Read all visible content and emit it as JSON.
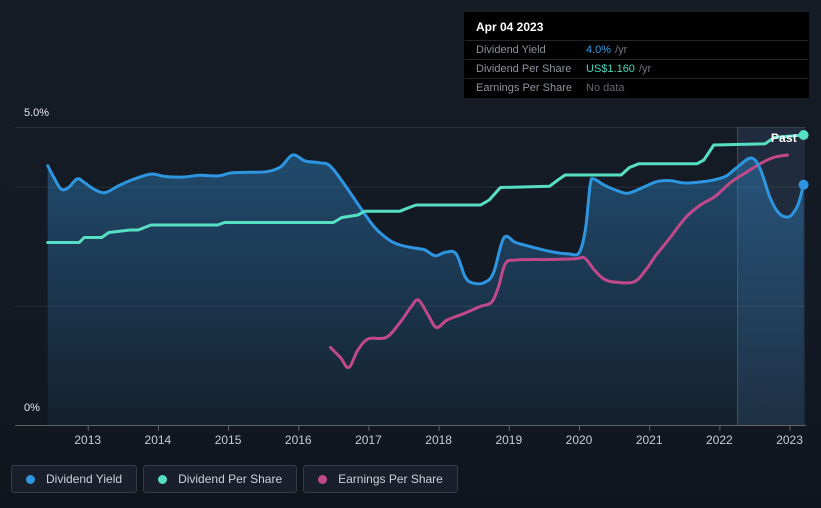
{
  "tooltip": {
    "date": "Apr 04 2023",
    "rows": [
      {
        "label": "Dividend Yield",
        "value": "4.0%",
        "suffix": "/yr",
        "value_color": "#2f9fe9"
      },
      {
        "label": "Dividend Per Share",
        "value": "US$1.160",
        "suffix": "/yr",
        "value_color": "#4cd6ba"
      },
      {
        "label": "Earnings Per Share",
        "value": "No data",
        "suffix": "",
        "value_color": "#62686f"
      }
    ]
  },
  "chart": {
    "past_label": "Past",
    "y_top_label": "5.0%",
    "y_bottom_label": "0%",
    "x_ticks": [
      "2013",
      "2014",
      "2015",
      "2016",
      "2017",
      "2018",
      "2019",
      "2020",
      "2021",
      "2022",
      "2023"
    ]
  },
  "legend": [
    {
      "label": "Dividend Yield",
      "color": "#2e96e0"
    },
    {
      "label": "Dividend Per Share",
      "color": "#57dfc4"
    },
    {
      "label": "Earnings Per Share",
      "color": "#c1498b"
    }
  ],
  "chart_data": {
    "type": "line",
    "xlim": [
      2012.42,
      2023.22
    ],
    "ylim_percent": [
      0,
      5
    ],
    "usd_axis_max": 1.192,
    "x_tick_years": [
      2013,
      2014,
      2015,
      2016,
      2017,
      2018,
      2019,
      2020,
      2021,
      2022,
      2023
    ],
    "y_tick_labels": [
      "5.0%",
      "0%"
    ],
    "gridline_percents": [
      5,
      4,
      2
    ],
    "grid": true,
    "legend_position": "bottom-left",
    "past_band_start_year": 2022.26,
    "series": [
      {
        "name": "Earnings Per Share",
        "unit": "USD",
        "axis": "usd",
        "color": "#c1498b",
        "smooth": true,
        "end_dot": false,
        "area_fill": false,
        "points": [
          [
            2016.46,
            0.31
          ],
          [
            2016.6,
            0.27
          ],
          [
            2016.72,
            0.23
          ],
          [
            2016.85,
            0.3
          ],
          [
            2017.0,
            0.345
          ],
          [
            2017.25,
            0.35
          ],
          [
            2017.45,
            0.41
          ],
          [
            2017.6,
            0.47
          ],
          [
            2017.71,
            0.5
          ],
          [
            2017.85,
            0.44
          ],
          [
            2017.97,
            0.39
          ],
          [
            2018.12,
            0.42
          ],
          [
            2018.35,
            0.445
          ],
          [
            2018.6,
            0.475
          ],
          [
            2018.75,
            0.49
          ],
          [
            2018.85,
            0.55
          ],
          [
            2018.95,
            0.645
          ],
          [
            2019.1,
            0.66
          ],
          [
            2019.6,
            0.662
          ],
          [
            2019.95,
            0.665
          ],
          [
            2020.08,
            0.668
          ],
          [
            2020.22,
            0.62
          ],
          [
            2020.35,
            0.585
          ],
          [
            2020.5,
            0.572
          ],
          [
            2020.78,
            0.572
          ],
          [
            2020.95,
            0.62
          ],
          [
            2021.1,
            0.68
          ],
          [
            2021.3,
            0.75
          ],
          [
            2021.52,
            0.83
          ],
          [
            2021.73,
            0.88
          ],
          [
            2021.94,
            0.915
          ],
          [
            2022.16,
            0.97
          ],
          [
            2022.38,
            1.01
          ],
          [
            2022.58,
            1.045
          ],
          [
            2022.77,
            1.07
          ],
          [
            2022.97,
            1.08
          ]
        ]
      },
      {
        "name": "Dividend Yield",
        "unit": "%",
        "axis": "percent",
        "color": "#2e96e0",
        "smooth": true,
        "end_dot": true,
        "area_fill": true,
        "points": [
          [
            2012.43,
            4.35
          ],
          [
            2012.52,
            4.15
          ],
          [
            2012.62,
            3.96
          ],
          [
            2012.72,
            3.98
          ],
          [
            2012.85,
            4.13
          ],
          [
            2012.95,
            4.07
          ],
          [
            2013.1,
            3.95
          ],
          [
            2013.25,
            3.9
          ],
          [
            2013.45,
            4.02
          ],
          [
            2013.65,
            4.12
          ],
          [
            2013.9,
            4.21
          ],
          [
            2014.1,
            4.17
          ],
          [
            2014.35,
            4.16
          ],
          [
            2014.6,
            4.19
          ],
          [
            2014.85,
            4.18
          ],
          [
            2015.05,
            4.23
          ],
          [
            2015.3,
            4.24
          ],
          [
            2015.55,
            4.25
          ],
          [
            2015.75,
            4.33
          ],
          [
            2015.92,
            4.53
          ],
          [
            2016.1,
            4.43
          ],
          [
            2016.3,
            4.4
          ],
          [
            2016.45,
            4.35
          ],
          [
            2016.65,
            4.05
          ],
          [
            2016.93,
            3.57
          ],
          [
            2017.1,
            3.3
          ],
          [
            2017.3,
            3.1
          ],
          [
            2017.45,
            3.02
          ],
          [
            2017.65,
            2.97
          ],
          [
            2017.8,
            2.94
          ],
          [
            2017.95,
            2.84
          ],
          [
            2018.1,
            2.9
          ],
          [
            2018.25,
            2.87
          ],
          [
            2018.38,
            2.48
          ],
          [
            2018.5,
            2.38
          ],
          [
            2018.65,
            2.39
          ],
          [
            2018.78,
            2.55
          ],
          [
            2018.93,
            3.14
          ],
          [
            2019.1,
            3.06
          ],
          [
            2019.35,
            2.98
          ],
          [
            2019.6,
            2.91
          ],
          [
            2019.85,
            2.87
          ],
          [
            2020.0,
            2.89
          ],
          [
            2020.09,
            3.27
          ],
          [
            2020.16,
            4.03
          ],
          [
            2020.21,
            4.13
          ],
          [
            2020.35,
            4.03
          ],
          [
            2020.55,
            3.93
          ],
          [
            2020.7,
            3.89
          ],
          [
            2020.9,
            3.98
          ],
          [
            2021.1,
            4.08
          ],
          [
            2021.3,
            4.1
          ],
          [
            2021.5,
            4.06
          ],
          [
            2021.75,
            4.08
          ],
          [
            2021.95,
            4.12
          ],
          [
            2022.1,
            4.18
          ],
          [
            2022.25,
            4.32
          ],
          [
            2022.45,
            4.48
          ],
          [
            2022.58,
            4.3
          ],
          [
            2022.72,
            3.82
          ],
          [
            2022.85,
            3.55
          ],
          [
            2022.98,
            3.49
          ],
          [
            2023.06,
            3.57
          ],
          [
            2023.13,
            3.73
          ],
          [
            2023.2,
            4.03
          ]
        ]
      },
      {
        "name": "Dividend Per Share",
        "unit": "USD",
        "axis": "usd",
        "color": "#57dfc4",
        "smooth": false,
        "end_dot": true,
        "area_fill": false,
        "points": [
          [
            2012.43,
            0.73
          ],
          [
            2012.88,
            0.73
          ],
          [
            2012.95,
            0.75
          ],
          [
            2013.2,
            0.75
          ],
          [
            2013.3,
            0.77
          ],
          [
            2013.6,
            0.78
          ],
          [
            2013.72,
            0.78
          ],
          [
            2013.9,
            0.8
          ],
          [
            2014.85,
            0.8
          ],
          [
            2014.95,
            0.81
          ],
          [
            2016.5,
            0.81
          ],
          [
            2016.62,
            0.83
          ],
          [
            2016.85,
            0.84
          ],
          [
            2016.95,
            0.855
          ],
          [
            2017.45,
            0.855
          ],
          [
            2017.58,
            0.87
          ],
          [
            2017.68,
            0.88
          ],
          [
            2018.6,
            0.88
          ],
          [
            2018.72,
            0.9
          ],
          [
            2018.88,
            0.95
          ],
          [
            2019.58,
            0.955
          ],
          [
            2019.7,
            0.98
          ],
          [
            2019.8,
            1.0
          ],
          [
            2020.6,
            1.0
          ],
          [
            2020.72,
            1.03
          ],
          [
            2020.85,
            1.045
          ],
          [
            2021.68,
            1.045
          ],
          [
            2021.78,
            1.06
          ],
          [
            2021.92,
            1.12
          ],
          [
            2022.65,
            1.125
          ],
          [
            2022.78,
            1.15
          ],
          [
            2023.2,
            1.16
          ]
        ]
      }
    ]
  }
}
